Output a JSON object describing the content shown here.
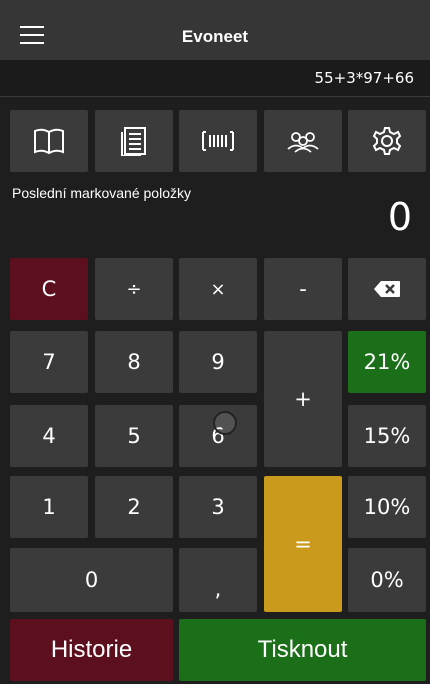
{
  "app": {
    "title": "Evoneet"
  },
  "expression": "55+3*97+66",
  "toolbar": {
    "icons": [
      "book-icon",
      "receipt-icon",
      "barcode-icon",
      "customers-icon",
      "gear-icon"
    ]
  },
  "recent": {
    "label": "Poslední markované položky"
  },
  "display": {
    "value": "0"
  },
  "keys": {
    "clear": "C",
    "divide": "÷",
    "multiply": "×",
    "minus": "-",
    "k7": "7",
    "k8": "8",
    "k9": "9",
    "k4": "4",
    "k5": "5",
    "k6": "6",
    "k1": "1",
    "k2": "2",
    "k3": "3",
    "k0": "0",
    "comma": ",",
    "plus": "+",
    "equals": "=",
    "p21": "21%",
    "p15": "15%",
    "p10": "10%",
    "p0": "0%"
  },
  "footer": {
    "history": "Historie",
    "print": "Tisknout"
  },
  "colors": {
    "danger": "#5c0f1c",
    "success": "#1b6f18",
    "equals": "#c99a1b",
    "key": "#3b3b3b",
    "titlebar": "#363636"
  }
}
